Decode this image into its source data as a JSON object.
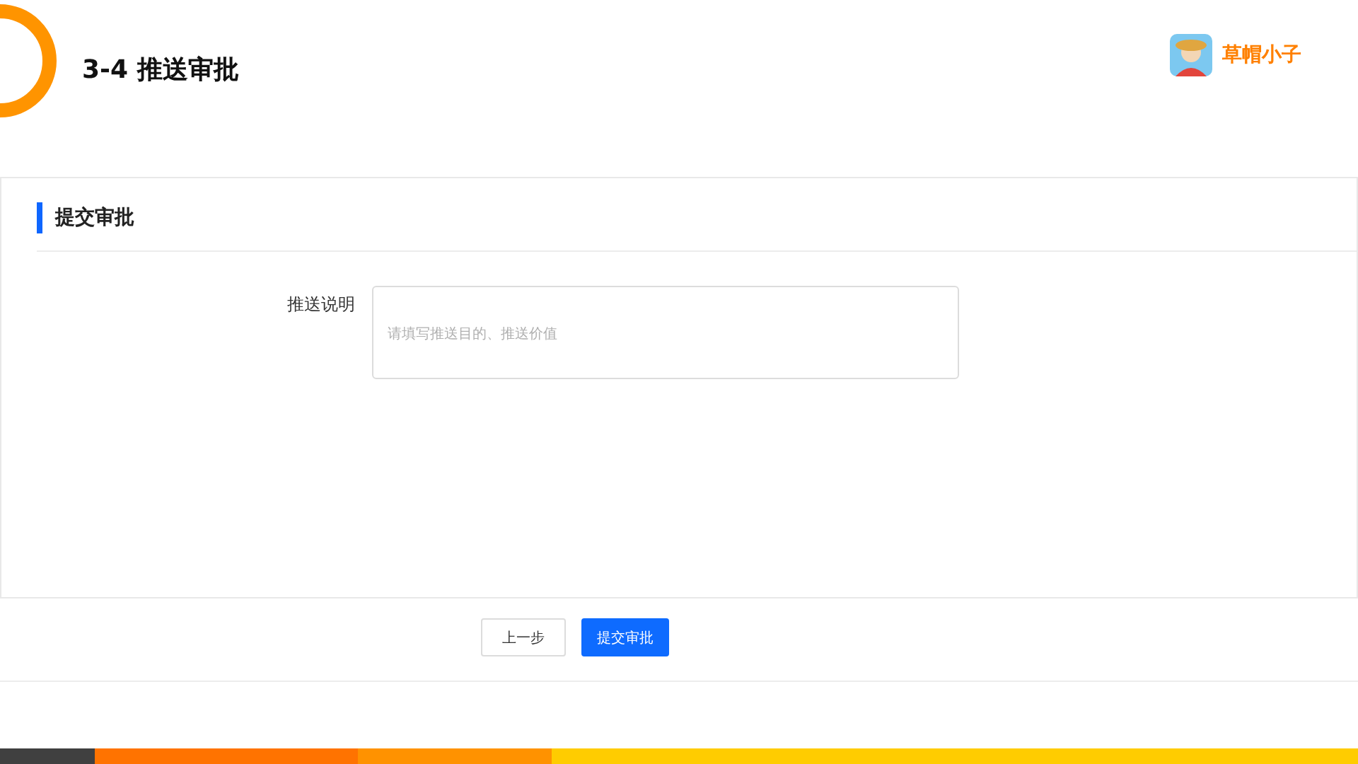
{
  "slide_title": "3-4 推送审批",
  "brand": {
    "name": "草帽小子"
  },
  "section": {
    "title": "提交审批"
  },
  "fields": [
    {
      "label": "推送说明",
      "placeholder": "请填写推送目的、推送价值"
    }
  ],
  "buttons": [
    {
      "label": "上一步",
      "kind": "default"
    },
    {
      "label": "提交审批",
      "kind": "primary"
    }
  ]
}
